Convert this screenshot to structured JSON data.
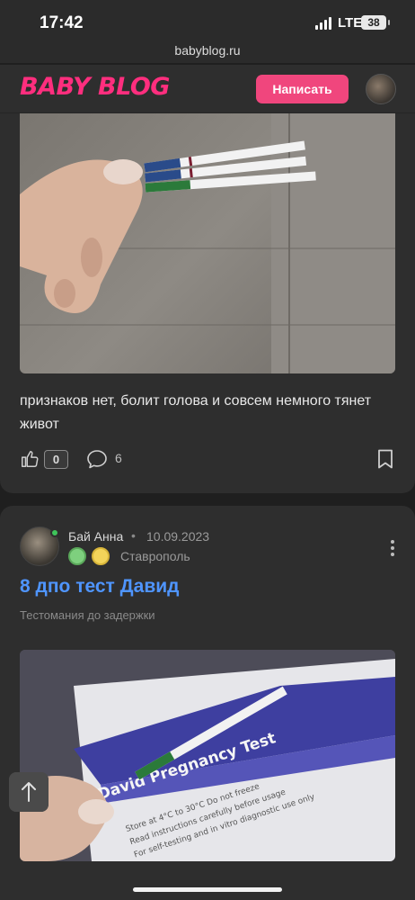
{
  "status_bar": {
    "time": "17:42",
    "network": "LTE",
    "battery": "38"
  },
  "browser": {
    "url": "babyblog.ru"
  },
  "header": {
    "logo": "BABY BLOG",
    "write_button": "Написать"
  },
  "post1": {
    "text": "признаков нет, болит голова и совсем немного тянет живот",
    "likes": "0",
    "comments": "6"
  },
  "post2": {
    "author": "Бай Анна",
    "separator": "•",
    "date": "10.09.2023",
    "city": "Ставрополь",
    "title": "8 дпо тест Давид",
    "category": "Тестомания до задержки"
  },
  "colors": {
    "accent_pink": "#f0467d",
    "logo_pink": "#ff2e7e",
    "title_blue": "#4f95ff",
    "online_green": "#3fc45a"
  },
  "icons": [
    "like-icon",
    "comment-icon",
    "bookmark-icon",
    "more-icon",
    "arrow-up-icon",
    "signal-icon"
  ]
}
